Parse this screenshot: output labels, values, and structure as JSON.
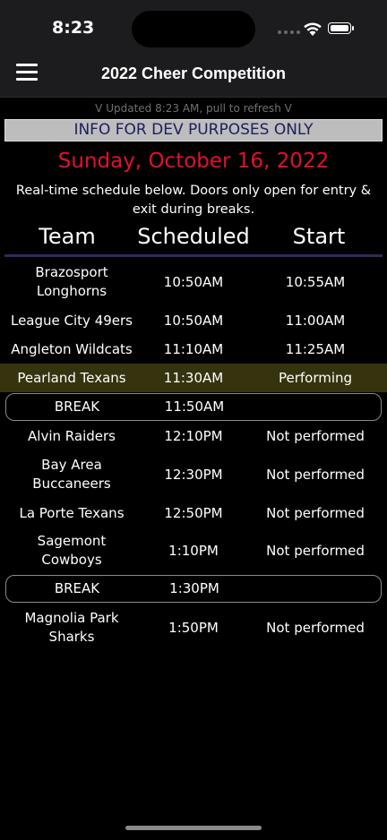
{
  "status_bar": {
    "time": "8:23"
  },
  "nav": {
    "title": "2022 Cheer Competition",
    "menu_icon": "hamburger-menu-icon"
  },
  "updated_text": "V  Updated 8:23 AM, pull to refresh  V",
  "dev_banner": "INFO FOR DEV PURPOSES ONLY",
  "date_heading": "Sunday, October 16, 2022",
  "intro_text": "Real-time schedule below. Doors only open for entry & exit during breaks.",
  "colors": {
    "date": "#e4102b",
    "performing_row": "#36340e",
    "header_line": "#2e2a62",
    "dev_banner_bg": "#bdbdbd"
  },
  "table": {
    "headers": {
      "team": "Team",
      "scheduled": "Scheduled",
      "start": "Start"
    },
    "rows": [
      {
        "team": "Brazosport Longhorns",
        "scheduled": "10:50AM",
        "start": "10:55AM"
      },
      {
        "team": "League City 49ers",
        "scheduled": "10:50AM",
        "start": "11:00AM"
      },
      {
        "team": "Angleton Wildcats",
        "scheduled": "11:10AM",
        "start": "11:25AM"
      },
      {
        "team": "Pearland Texans",
        "scheduled": "11:30AM",
        "start": "Performing"
      },
      {
        "team": "BREAK",
        "scheduled": "11:50AM",
        "start": ""
      },
      {
        "team": "Alvin Raiders",
        "scheduled": "12:10PM",
        "start": "Not performed"
      },
      {
        "team": "Bay Area Buccaneers",
        "scheduled": "12:30PM",
        "start": "Not performed"
      },
      {
        "team": "La Porte Texans",
        "scheduled": "12:50PM",
        "start": "Not performed"
      },
      {
        "team": "Sagemont Cowboys",
        "scheduled": "1:10PM",
        "start": "Not performed"
      },
      {
        "team": "BREAK",
        "scheduled": "1:30PM",
        "start": ""
      },
      {
        "team": "Magnolia Park Sharks",
        "scheduled": "1:50PM",
        "start": "Not performed"
      }
    ]
  }
}
